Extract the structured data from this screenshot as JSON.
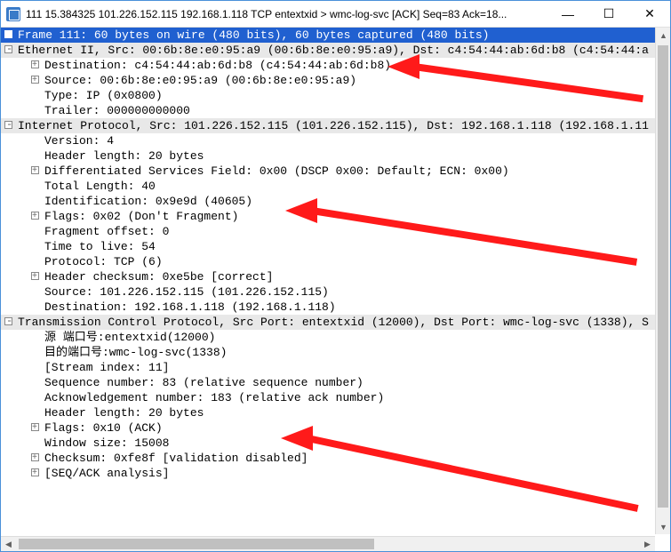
{
  "window": {
    "title": "111 15.384325 101.226.152.115 192.168.1.118 TCP entextxid > wmc-log-svc [ACK] Seq=83 Ack=18..."
  },
  "frame": {
    "summary": "Frame 111: 60 bytes on wire (480 bits), 60 bytes captured (480 bits)"
  },
  "ethernet": {
    "summary": "Ethernet II, Src: 00:6b:8e:e0:95:a9 (00:6b:8e:e0:95:a9), Dst: c4:54:44:ab:6d:b8 (c4:54:44:a",
    "destination": "Destination: c4:54:44:ab:6d:b8 (c4:54:44:ab:6d:b8)",
    "source": "Source: 00:6b:8e:e0:95:a9 (00:6b:8e:e0:95:a9)",
    "type": "Type: IP (0x0800)",
    "trailer": "Trailer: 000000000000"
  },
  "ip": {
    "summary": "Internet Protocol, Src: 101.226.152.115 (101.226.152.115), Dst: 192.168.1.118 (192.168.1.11",
    "version": "Version: 4",
    "header_length": "Header length: 20 bytes",
    "dsf": "Differentiated Services Field: 0x00 (DSCP 0x00: Default; ECN: 0x00)",
    "total_length": "Total Length: 40",
    "identification": "Identification: 0x9e9d (40605)",
    "flags": "Flags: 0x02 (Don't Fragment)",
    "fragment_offset": "Fragment offset: 0",
    "ttl": "Time to live: 54",
    "protocol": "Protocol: TCP (6)",
    "checksum": "Header checksum: 0xe5be [correct]",
    "source": "Source: 101.226.152.115 (101.226.152.115)",
    "destination": "Destination: 192.168.1.118 (192.168.1.118)"
  },
  "tcp": {
    "summary": "Transmission Control Protocol, Src Port: entextxid (12000), Dst Port: wmc-log-svc (1338), S",
    "src_port": "源  端口号:entextxid(12000)",
    "dst_port": "目的端口号:wmc-log-svc(1338)",
    "stream": "[Stream index: 11]",
    "seq": "Sequence number: 83    (relative sequence number)",
    "ack": "Acknowledgement number: 183    (relative ack number)",
    "header_length": "Header length: 20 bytes",
    "flags": "Flags: 0x10 (ACK)",
    "window": "Window size: 15008",
    "checksum": "Checksum: 0xfe8f [validation disabled]",
    "seq_ack": "[SEQ/ACK analysis]"
  }
}
